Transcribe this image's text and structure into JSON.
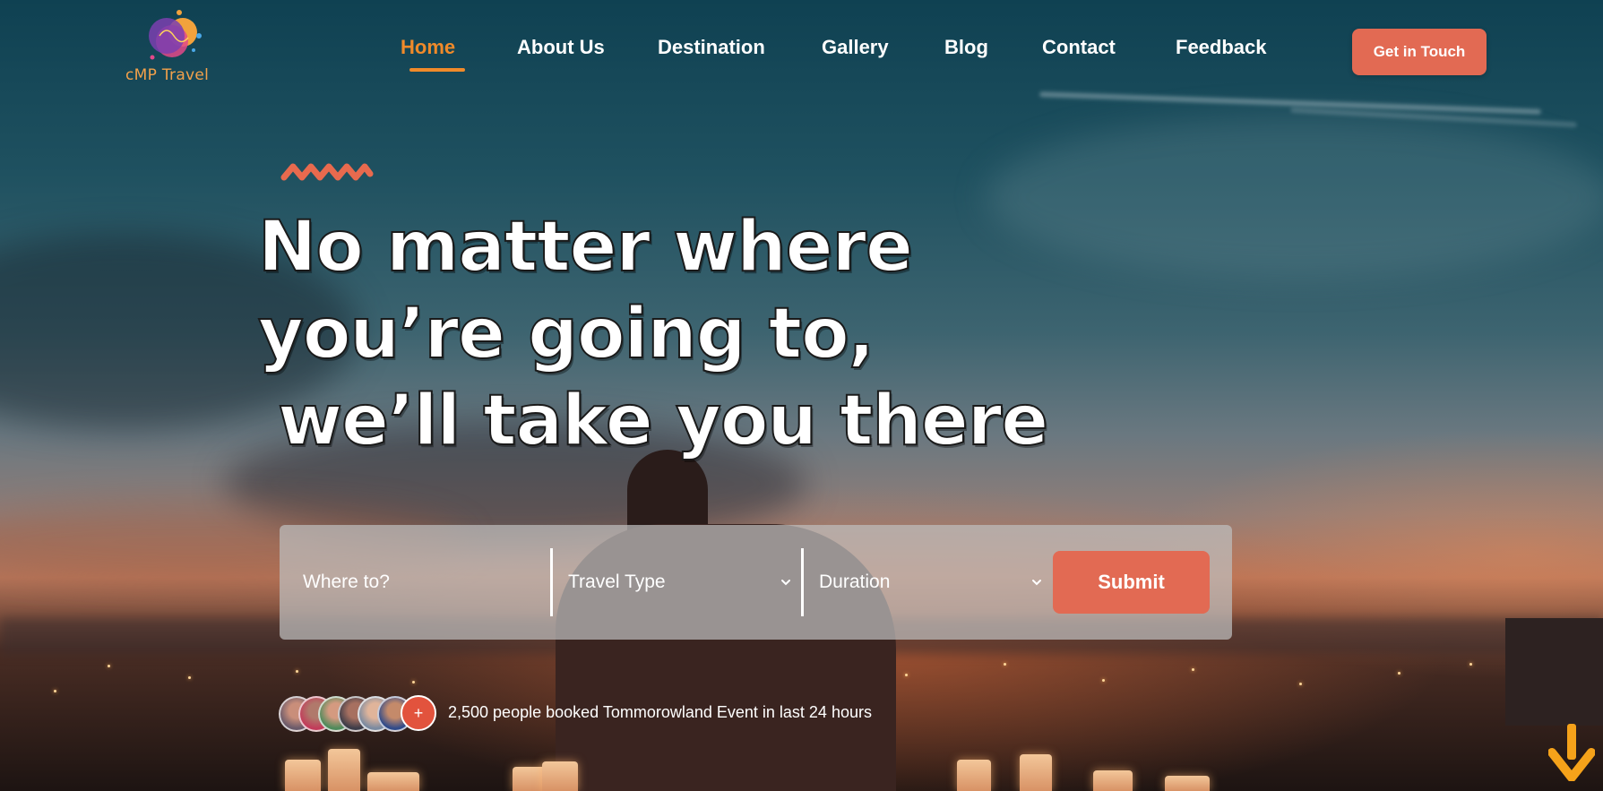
{
  "brand": {
    "name": "cMP Travel"
  },
  "nav": {
    "items": [
      {
        "label": "Home",
        "active": true
      },
      {
        "label": "About Us",
        "active": false
      },
      {
        "label": "Destination",
        "active": false
      },
      {
        "label": "Gallery",
        "active": false
      },
      {
        "label": "Blog",
        "active": false
      },
      {
        "label": "Contact",
        "active": false
      },
      {
        "label": "Feedback",
        "active": false
      }
    ],
    "cta_label": "Get in Touch"
  },
  "hero": {
    "headline_lines": [
      "No matter where",
      "you’re going to,",
      "we’ll take you there"
    ]
  },
  "search": {
    "where_placeholder": "Where to?",
    "travel_type_label": "Travel Type",
    "duration_label": "Duration",
    "submit_label": "Submit"
  },
  "social_proof": {
    "more_label": "+",
    "text": "2,500 people booked Tommorowland Event in last 24 hours"
  },
  "colors": {
    "accent": "#e26a53",
    "active_nav": "#f08a2a",
    "arrow": "#f5a21a"
  },
  "icons": [
    "chevron-down-icon",
    "arrow-down-icon",
    "zigzag-decoration"
  ]
}
